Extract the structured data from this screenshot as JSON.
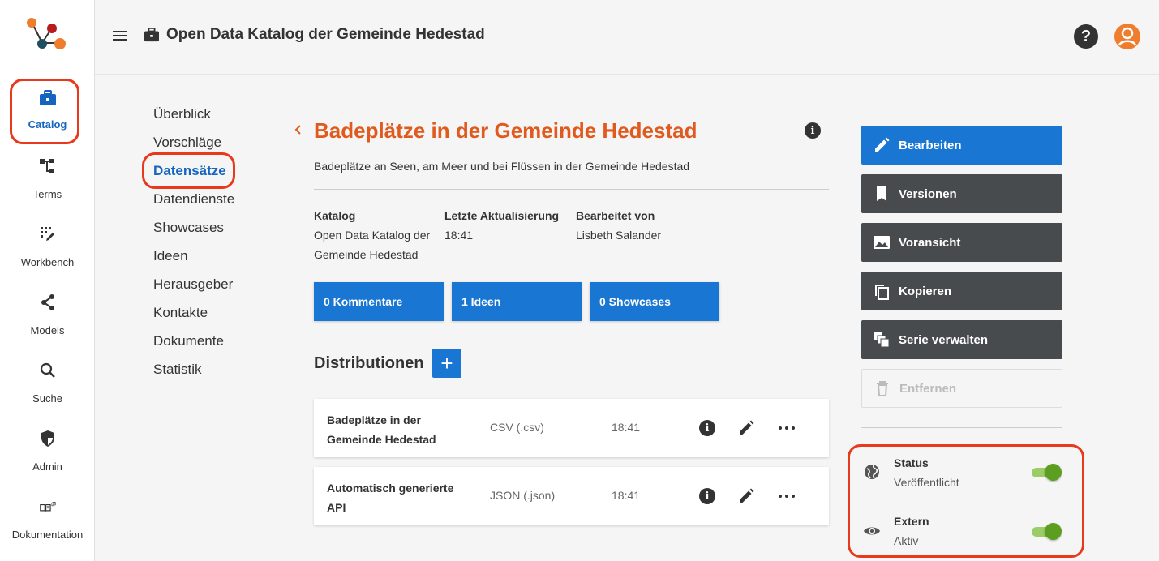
{
  "header": {
    "title": "Open Data Katalog der Gemeinde Hedestad",
    "help_label": "?"
  },
  "rail": {
    "items": [
      {
        "label": "Catalog",
        "icon": "briefcase-icon",
        "active": true
      },
      {
        "label": "Terms",
        "icon": "hierarchy-icon"
      },
      {
        "label": "Workbench",
        "icon": "workbench-icon"
      },
      {
        "label": "Models",
        "icon": "share-nodes-icon"
      },
      {
        "label": "Suche",
        "icon": "search-icon"
      },
      {
        "label": "Admin",
        "icon": "shield-icon"
      },
      {
        "label": "Dokumentation",
        "icon": "book-external-icon"
      }
    ]
  },
  "subnav": {
    "items": [
      "Überblick",
      "Vorschläge",
      "Datensätze",
      "Datendienste",
      "Showcases",
      "Ideen",
      "Herausgeber",
      "Kontakte",
      "Dokumente",
      "Statistik"
    ],
    "active_index": 2
  },
  "dataset": {
    "title": "Badeplätze in der Gemeinde Hedestad",
    "description": "Badeplätze an Seen, am Meer und bei Flüssen in der Gemeinde Hedestad",
    "info_label": "i",
    "meta": {
      "catalog_label": "Katalog",
      "catalog_value_1": "Open Data Katalog der",
      "catalog_value_2": "Gemeinde Hedestad",
      "updated_label": "Letzte Aktualisierung",
      "updated_value": "18:41",
      "editor_label": "Bearbeitet von",
      "editor_value": "Lisbeth Salander"
    },
    "counts": {
      "comments": "0  Kommentare",
      "ideas": "1  Ideen",
      "showcases": "0  Showcases"
    }
  },
  "distributions": {
    "heading": "Distributionen",
    "add_label": "+",
    "rows": [
      {
        "name": "Badeplätze in der Gemeinde Hedestad",
        "format": "CSV (.csv)",
        "time": "18:41"
      },
      {
        "name": "Automatisch generierte API",
        "format": "JSON (.json)",
        "time": "18:41"
      }
    ]
  },
  "actions": {
    "edit": "Bearbeiten",
    "versions": "Versionen",
    "preview": "Voransicht",
    "copy": "Kopieren",
    "series": "Serie verwalten",
    "remove": "Entfernen"
  },
  "status": {
    "status_label": "Status",
    "status_value": "Veröffentlicht",
    "status_on": true,
    "extern_label": "Extern",
    "extern_value": "Aktiv",
    "extern_on": true
  },
  "colors": {
    "accent": "#1976d2",
    "title": "#e05a1e",
    "highlight": "#e8391d",
    "toggle": "#5c9e1f",
    "dark_button": "#484b4e"
  }
}
